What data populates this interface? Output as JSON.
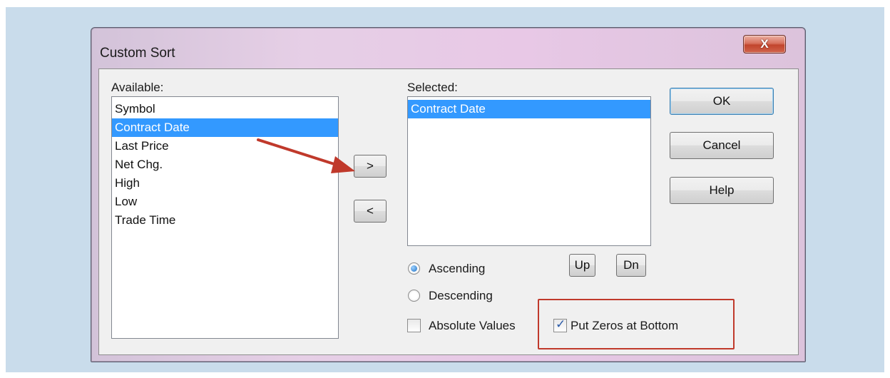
{
  "window": {
    "title": "Custom Sort",
    "close_glyph": "X"
  },
  "available": {
    "label": "Available:",
    "items": [
      "Symbol",
      "Contract Date",
      "Last Price",
      "Net Chg.",
      "High",
      "Low",
      "Trade Time"
    ],
    "selected_index": 1
  },
  "selected": {
    "label": "Selected:",
    "items": [
      "Contract Date"
    ],
    "selected_index": 0
  },
  "buttons": {
    "add": ">",
    "remove": "<",
    "ok": "OK",
    "cancel": "Cancel",
    "help": "Help",
    "up": "Up",
    "dn": "Dn"
  },
  "order": {
    "ascending": "Ascending",
    "descending": "Descending",
    "checked": "ascending"
  },
  "options": {
    "absolute_values": {
      "label": "Absolute Values",
      "checked": false
    },
    "put_zeros_at_bottom": {
      "label": "Put Zeros at Bottom",
      "checked": true
    }
  },
  "colors": {
    "selection": "#3399ff",
    "annotation": "#c0392b"
  },
  "icons": {
    "close": "close-icon",
    "annotation": "arrow-annotation-icon"
  }
}
